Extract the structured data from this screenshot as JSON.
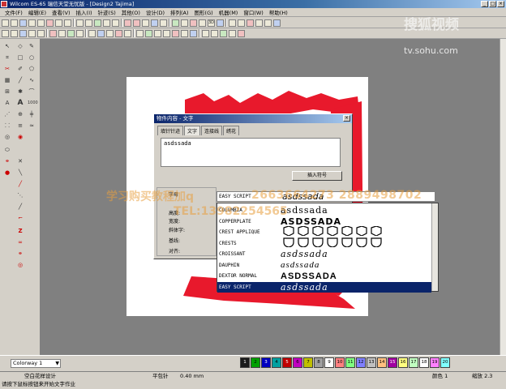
{
  "window": {
    "title": "Wilcom ES-65 瑞信天堂无忧版 - [Design2          Tajima]"
  },
  "menu": [
    "文件(F)",
    "编辑(E)",
    "查看(V)",
    "插入(I)",
    "针迹(S)",
    "其他(O)",
    "设计(D)",
    "排列(A)",
    "图形(G)",
    "机器(M)",
    "窗口(W)",
    "帮助(H)"
  ],
  "watermark": {
    "logo": "搜狐视频",
    "url": "tv.sohu.com"
  },
  "dialog": {
    "title": "物件内容 - 文字",
    "tabs": [
      "填针针迹",
      "文字",
      "连接线",
      "绣花"
    ],
    "text_value": "asdssada",
    "insert_button": "插入符号",
    "labels": {
      "font": "字母",
      "height": "高度:",
      "width": "宽度:",
      "italic": "斜体字:",
      "baseline": "基线:",
      "align": "对齐:"
    },
    "font_combo_value": "EASY SCRIPT",
    "font_list": [
      {
        "name": "COLUMBIA",
        "sample": "asdssada"
      },
      {
        "name": "COPPERPLATE",
        "sample": "ASDSSADA"
      },
      {
        "name": "CREST APPLIQUE",
        "sample": ""
      },
      {
        "name": "CRESTS",
        "sample": ""
      },
      {
        "name": "CROISSANT",
        "sample": "asdssada"
      },
      {
        "name": "DAUPHIN",
        "sample": "asdssada"
      },
      {
        "name": "DEXTOR NORMAL",
        "sample": "ASDSSADA"
      },
      {
        "name": "EASY SCRIPT",
        "sample": "asdssada",
        "selected": true
      }
    ]
  },
  "overlay": {
    "line1": "学习购买教程加q",
    "line1_b": "2663664273 2889498702",
    "line2": "TEL:13982254565"
  },
  "bottom": {
    "colorway": "Colorway 1",
    "swatch_numbers": [
      "1",
      "2",
      "3",
      "4",
      "5",
      "6",
      "7",
      "8",
      "9",
      "10",
      "11",
      "12",
      "13",
      "14",
      "15",
      "16",
      "17",
      "18",
      "19",
      "20"
    ],
    "swatch_colors": [
      "#1a1a1a",
      "#00a000",
      "#0000c0",
      "#00a0a0",
      "#c00000",
      "#c000c0",
      "#c0c000",
      "#a0a0a0",
      "#ffffff",
      "#ff8080",
      "#80ff80",
      "#8080ff",
      "#c0c0c0",
      "#ffc080",
      "#a000a0",
      "#ffff80",
      "#c0ffc0",
      "#ffffff",
      "#ff80ff",
      "#80ffff"
    ]
  },
  "status": {
    "design": "空白花样设计",
    "stitch": "平包针",
    "stitch_len": "0.40 mm",
    "color_label": "颜色 1",
    "zoom_label": "缩放 2.3",
    "hint": "请按下鼠标按钮来开始文字作业"
  },
  "colors": {
    "accent": "#0a246a",
    "embroidery_red": "#e8192c",
    "workspace": "#808080"
  }
}
